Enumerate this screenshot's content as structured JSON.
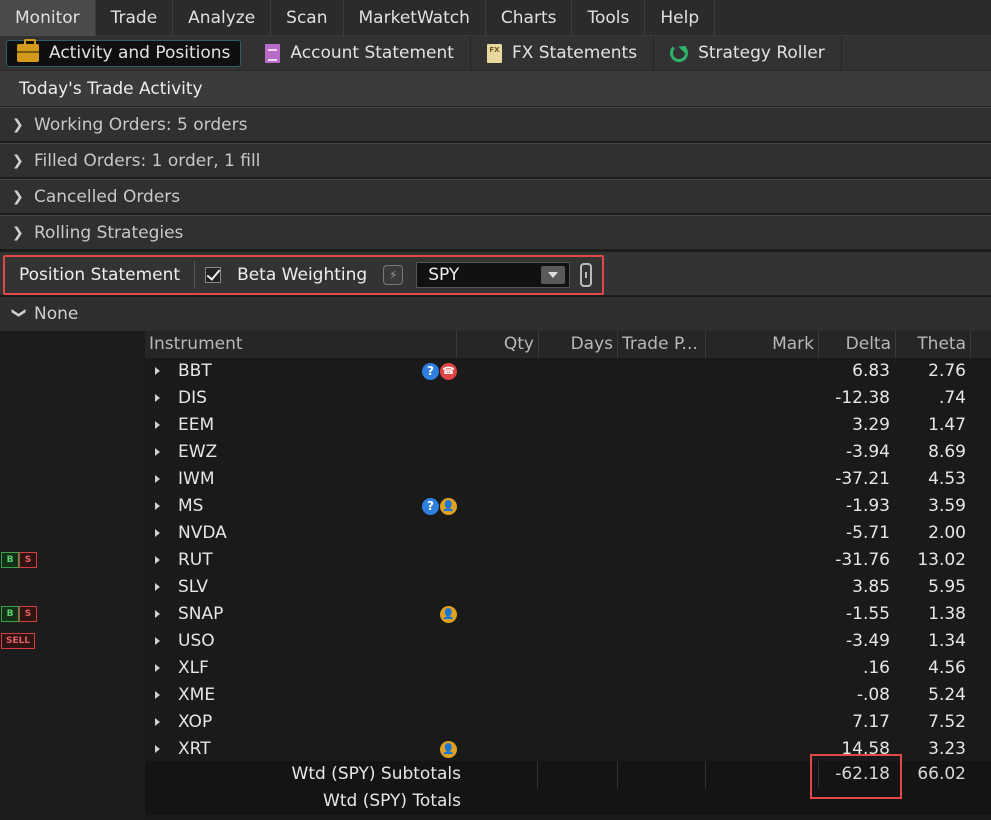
{
  "menu": [
    "Monitor",
    "Trade",
    "Analyze",
    "Scan",
    "MarketWatch",
    "Charts",
    "Tools",
    "Help"
  ],
  "subtabs": [
    "Activity and Positions",
    "Account Statement",
    "FX Statements",
    "Strategy Roller"
  ],
  "section_title": "Today's Trade Activity",
  "collapsibles": [
    "Working Orders: 5 orders",
    "Filled Orders: 1 order, 1 fill",
    "Cancelled Orders",
    "Rolling Strategies"
  ],
  "position": {
    "label": "Position Statement",
    "beta_label": "Beta Weighting",
    "beta_symbol": "SPY",
    "group": "None"
  },
  "table": {
    "headers": [
      "Instrument",
      "Qty",
      "Days",
      "Trade P...",
      "Mark",
      "Delta",
      "Theta"
    ],
    "rows": [
      {
        "sym": "BBT",
        "delta": "6.83",
        "theta": "2.76"
      },
      {
        "sym": "DIS",
        "delta": "-12.38",
        "theta": ".74"
      },
      {
        "sym": "EEM",
        "delta": "3.29",
        "theta": "1.47"
      },
      {
        "sym": "EWZ",
        "delta": "-3.94",
        "theta": "8.69"
      },
      {
        "sym": "IWM",
        "delta": "-37.21",
        "theta": "4.53"
      },
      {
        "sym": "MS",
        "delta": "-1.93",
        "theta": "3.59"
      },
      {
        "sym": "NVDA",
        "delta": "-5.71",
        "theta": "2.00"
      },
      {
        "sym": "RUT",
        "delta": "-31.76",
        "theta": "13.02"
      },
      {
        "sym": "SLV",
        "delta": "3.85",
        "theta": "5.95"
      },
      {
        "sym": "SNAP",
        "delta": "-1.55",
        "theta": "1.38"
      },
      {
        "sym": "USO",
        "delta": "-3.49",
        "theta": "1.34"
      },
      {
        "sym": "XLF",
        "delta": ".16",
        "theta": "4.56"
      },
      {
        "sym": "XME",
        "delta": "-.08",
        "theta": "5.24"
      },
      {
        "sym": "XOP",
        "delta": "7.17",
        "theta": "7.52"
      },
      {
        "sym": "XRT",
        "delta": "14.58",
        "theta": "3.23"
      }
    ],
    "subtotal_label": "Wtd (SPY) Subtotals",
    "subtotal_delta": "-62.18",
    "subtotal_theta": "66.02",
    "total_label": "Wtd (SPY) Totals"
  },
  "badges": {
    "question": "?",
    "phone": "☎",
    "person": "👤"
  },
  "markers": {
    "buy": "B",
    "sell_short": "S",
    "sell": "SELL"
  }
}
